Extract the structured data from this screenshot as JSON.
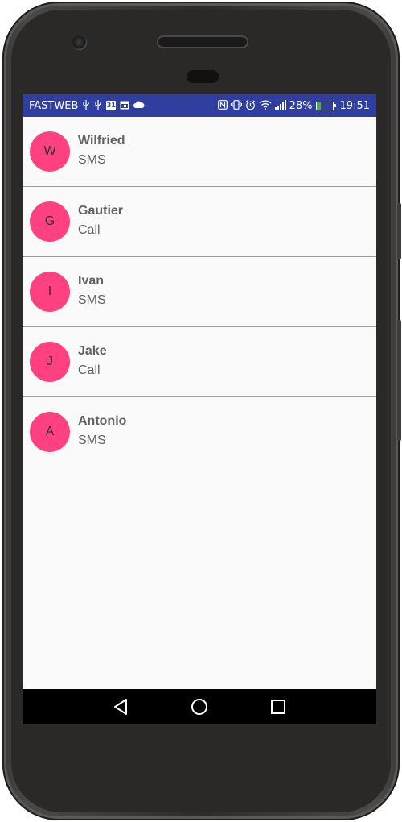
{
  "status_bar": {
    "carrier": "FASTWEB",
    "battery_percent": "28%",
    "battery_level": 0.28,
    "time": "19:51",
    "calendar_day": "31",
    "left_icons": [
      "usb-icon",
      "usb-icon",
      "calendar-icon",
      "calendar-event-icon",
      "cloud-icon"
    ],
    "right_icons": [
      "nfc-icon",
      "vibrate-icon",
      "alarm-icon",
      "wifi-icon",
      "signal-icon",
      "battery-charging-icon"
    ]
  },
  "contacts": [
    {
      "initial": "W",
      "name": "Wilfried",
      "type": "SMS"
    },
    {
      "initial": "G",
      "name": "Gautier",
      "type": "Call"
    },
    {
      "initial": "I",
      "name": "Ivan",
      "type": "SMS"
    },
    {
      "initial": "J",
      "name": "Jake",
      "type": "Call"
    },
    {
      "initial": "A",
      "name": "Antonio",
      "type": "SMS"
    }
  ],
  "navigation": {
    "back_icon": "back-triangle-icon",
    "home_icon": "home-circle-icon",
    "recents_icon": "recents-square-icon"
  },
  "colors": {
    "status_bar": "#303f9f",
    "avatar": "#ff4081",
    "nav_bar": "#000000",
    "list_background": "#fafafa"
  }
}
